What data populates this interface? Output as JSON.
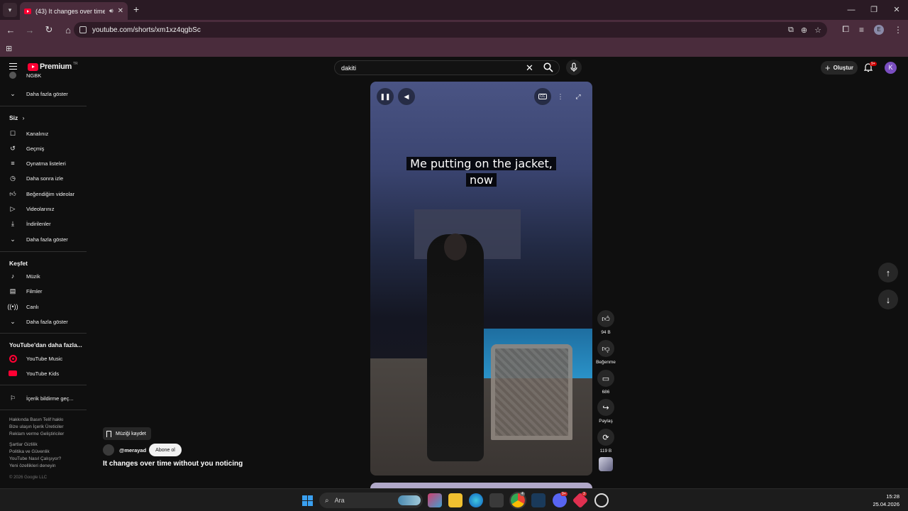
{
  "browser": {
    "tab_title": "(43) It changes over time w",
    "new_tab": "+",
    "url": "youtube.com/shorts/xm1xz4qgbSc",
    "profile_initial": "E"
  },
  "header": {
    "logo_text": "Premium",
    "logo_cc": "TR",
    "search_value": "dakiti",
    "create_label": "Oluştur",
    "notifications_badge": "9+",
    "avatar_initial": "K"
  },
  "sidebar": {
    "top_partial": "NGBK",
    "show_more_1": "Daha fazla göster",
    "you_section": "Siz",
    "you_items": [
      {
        "label": "Kanalınız",
        "icon": "user-icon"
      },
      {
        "label": "Geçmiş",
        "icon": "history-icon"
      },
      {
        "label": "Oynatma listeleri",
        "icon": "playlist-icon"
      },
      {
        "label": "Daha sonra izle",
        "icon": "clock-icon"
      },
      {
        "label": "Beğendiğim videolar",
        "icon": "like-icon"
      },
      {
        "label": "Videolarınız",
        "icon": "video-icon"
      },
      {
        "label": "İndirilenler",
        "icon": "download-icon"
      },
      {
        "label": "Daha fazla göster",
        "icon": "chevron-down-icon"
      }
    ],
    "explore_section": "Keşfet",
    "explore_items": [
      {
        "label": "Müzik",
        "icon": "music-icon"
      },
      {
        "label": "Filmler",
        "icon": "film-icon"
      },
      {
        "label": "Canlı",
        "icon": "live-icon"
      },
      {
        "label": "Daha fazla göster",
        "icon": "chevron-down-icon"
      }
    ],
    "more_section": "YouTube'dan daha fazla...",
    "more_items": [
      {
        "label": "YouTube Music",
        "icon": "youtube-music-icon"
      },
      {
        "label": "YouTube Kids",
        "icon": "youtube-kids-icon"
      }
    ],
    "report_item": "İçerik bildirme geç...",
    "footer_1": "Hakkında  Basın  Telif hakkı\nBize ulaşın  İçerik Üreticiler\nReklam verme  Geliştiriciler",
    "footer_2": "Şartlar  Gizlilik\nPolitika ve Güvenlik\nYouTube Nasıl Çalışıyor?\nYeni özellikleri deneyin",
    "copyright": "© 2026 Google LLC"
  },
  "video": {
    "caption_line1": "Me putting on the jacket,",
    "caption_line2": "now",
    "save_music": "Müziği kaydet",
    "channel": "@merayad",
    "subscribe": "Abone ol",
    "title": "It changes over time without you noticing"
  },
  "actions": {
    "like_count": "94 B",
    "dislike_label": "Beğenme",
    "comments_count": "686",
    "share_label": "Paylaş",
    "remix_count": "119 B"
  },
  "taskbar": {
    "search_placeholder": "Ara",
    "time": "15:28",
    "date": "25.04.2026",
    "badges": [
      "4",
      "9+",
      "3"
    ]
  }
}
